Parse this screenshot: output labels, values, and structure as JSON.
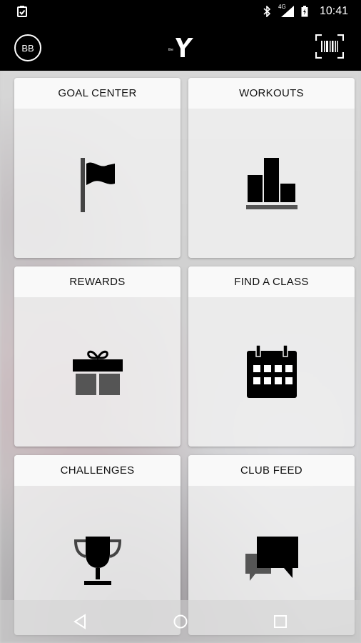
{
  "status_bar": {
    "time": "10:41",
    "network": "4G",
    "icons": [
      "clipboard-check-icon",
      "bluetooth-icon",
      "signal-icon",
      "battery-icon"
    ]
  },
  "app_bar": {
    "avatar_initials": "BB",
    "logo": "ymca-logo",
    "scan_icon": "barcode-scan-icon"
  },
  "tiles": [
    {
      "label": "GOAL CENTER",
      "icon": "flag-icon"
    },
    {
      "label": "WORKOUTS",
      "icon": "bar-chart-icon"
    },
    {
      "label": "REWARDS",
      "icon": "gift-icon"
    },
    {
      "label": "FIND A CLASS",
      "icon": "calendar-icon"
    },
    {
      "label": "CHALLENGES",
      "icon": "trophy-icon"
    },
    {
      "label": "CLUB FEED",
      "icon": "chat-bubbles-icon"
    }
  ],
  "nav_bar": {
    "buttons": [
      "back-icon",
      "home-icon",
      "recents-icon"
    ]
  },
  "colors": {
    "bar": "#000000",
    "tile": "#f0f0f0",
    "icon": "#111111"
  }
}
